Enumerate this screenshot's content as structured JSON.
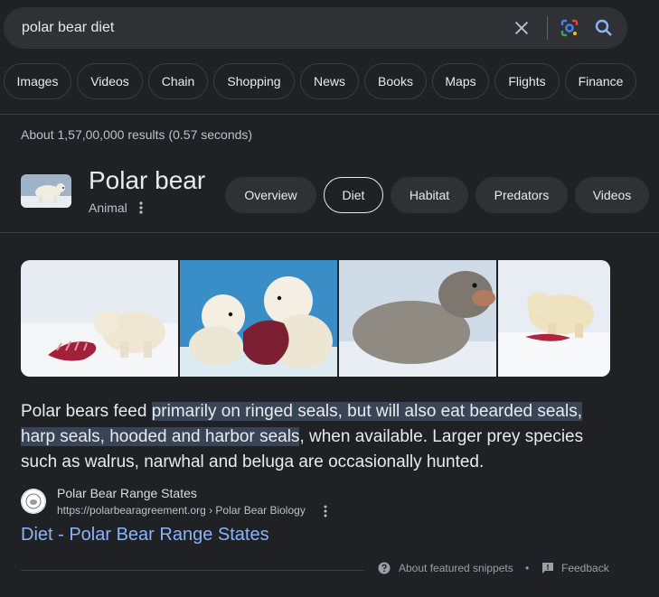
{
  "search": {
    "query": "polar bear diet"
  },
  "chips": [
    "Images",
    "Videos",
    "Chain",
    "Shopping",
    "News",
    "Books",
    "Maps",
    "Flights",
    "Finance"
  ],
  "stats": "About 1,57,00,000 results (0.57 seconds)",
  "knowledge_panel": {
    "title": "Polar bear",
    "subtitle": "Animal",
    "tabs": [
      {
        "label": "Overview",
        "selected": false
      },
      {
        "label": "Diet",
        "selected": true
      },
      {
        "label": "Habitat",
        "selected": false
      },
      {
        "label": "Predators",
        "selected": false
      },
      {
        "label": "Videos",
        "selected": false
      }
    ]
  },
  "snippet": {
    "before": "Polar bears feed ",
    "highlight": "primarily on ringed seals, but will also eat bearded seals, harp seals, hooded and harbor seals",
    "after": ", when available. Larger prey species such as walrus, narwhal and beluga are occasionally hunted."
  },
  "source": {
    "name": "Polar Bear Range States",
    "url": "https://polarbearagreement.org › Polar Bear Biology",
    "link_title": "Diet - Polar Bear Range States"
  },
  "footer": {
    "about": "About featured snippets",
    "separator": "•",
    "feedback": "Feedback"
  },
  "icons": {
    "clear": "close-icon",
    "lens": "google-lens-icon",
    "search": "search-icon",
    "more": "more-vert-icon",
    "help": "help-icon",
    "feedback": "feedback-icon"
  },
  "colors": {
    "background": "#202124",
    "link": "#8ab4f8",
    "highlight": "#394457"
  }
}
